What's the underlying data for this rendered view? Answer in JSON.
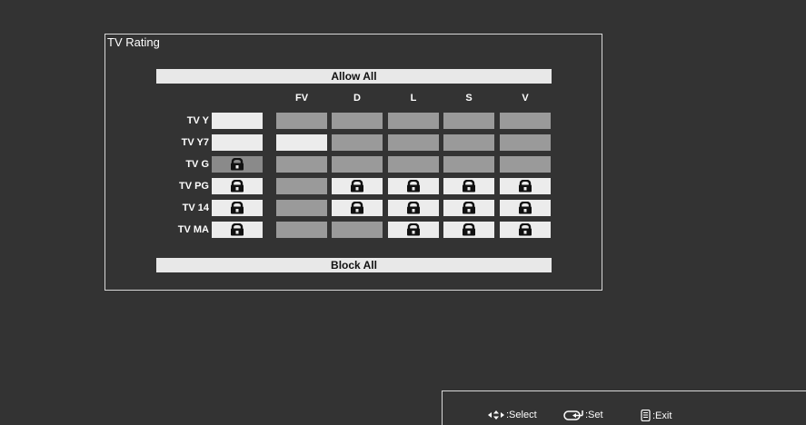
{
  "panel": {
    "title": "TV Rating",
    "allow_all": "Allow All",
    "block_all": "Block All"
  },
  "columns": [
    "FV",
    "D",
    "L",
    "S",
    "V"
  ],
  "rows": [
    {
      "label": "TV Y",
      "main": "light",
      "cells": [
        "gray",
        "gray",
        "gray",
        "gray",
        "gray"
      ]
    },
    {
      "label": "TV Y7",
      "main": "light",
      "cells": [
        "light",
        "gray",
        "gray",
        "gray",
        "gray"
      ]
    },
    {
      "label": "TV G",
      "main": "lock-selected",
      "cells": [
        "gray",
        "gray",
        "gray",
        "gray",
        "gray"
      ]
    },
    {
      "label": "TV PG",
      "main": "lock",
      "cells": [
        "gray",
        "lock",
        "lock",
        "lock",
        "lock"
      ]
    },
    {
      "label": "TV 14",
      "main": "lock",
      "cells": [
        "gray",
        "lock",
        "lock",
        "lock",
        "lock"
      ]
    },
    {
      "label": "TV MA",
      "main": "lock",
      "cells": [
        "gray",
        "gray",
        "lock",
        "lock",
        "lock"
      ]
    }
  ],
  "footer": {
    "select": ":Select",
    "set": ":Set",
    "exit": ":Exit"
  }
}
